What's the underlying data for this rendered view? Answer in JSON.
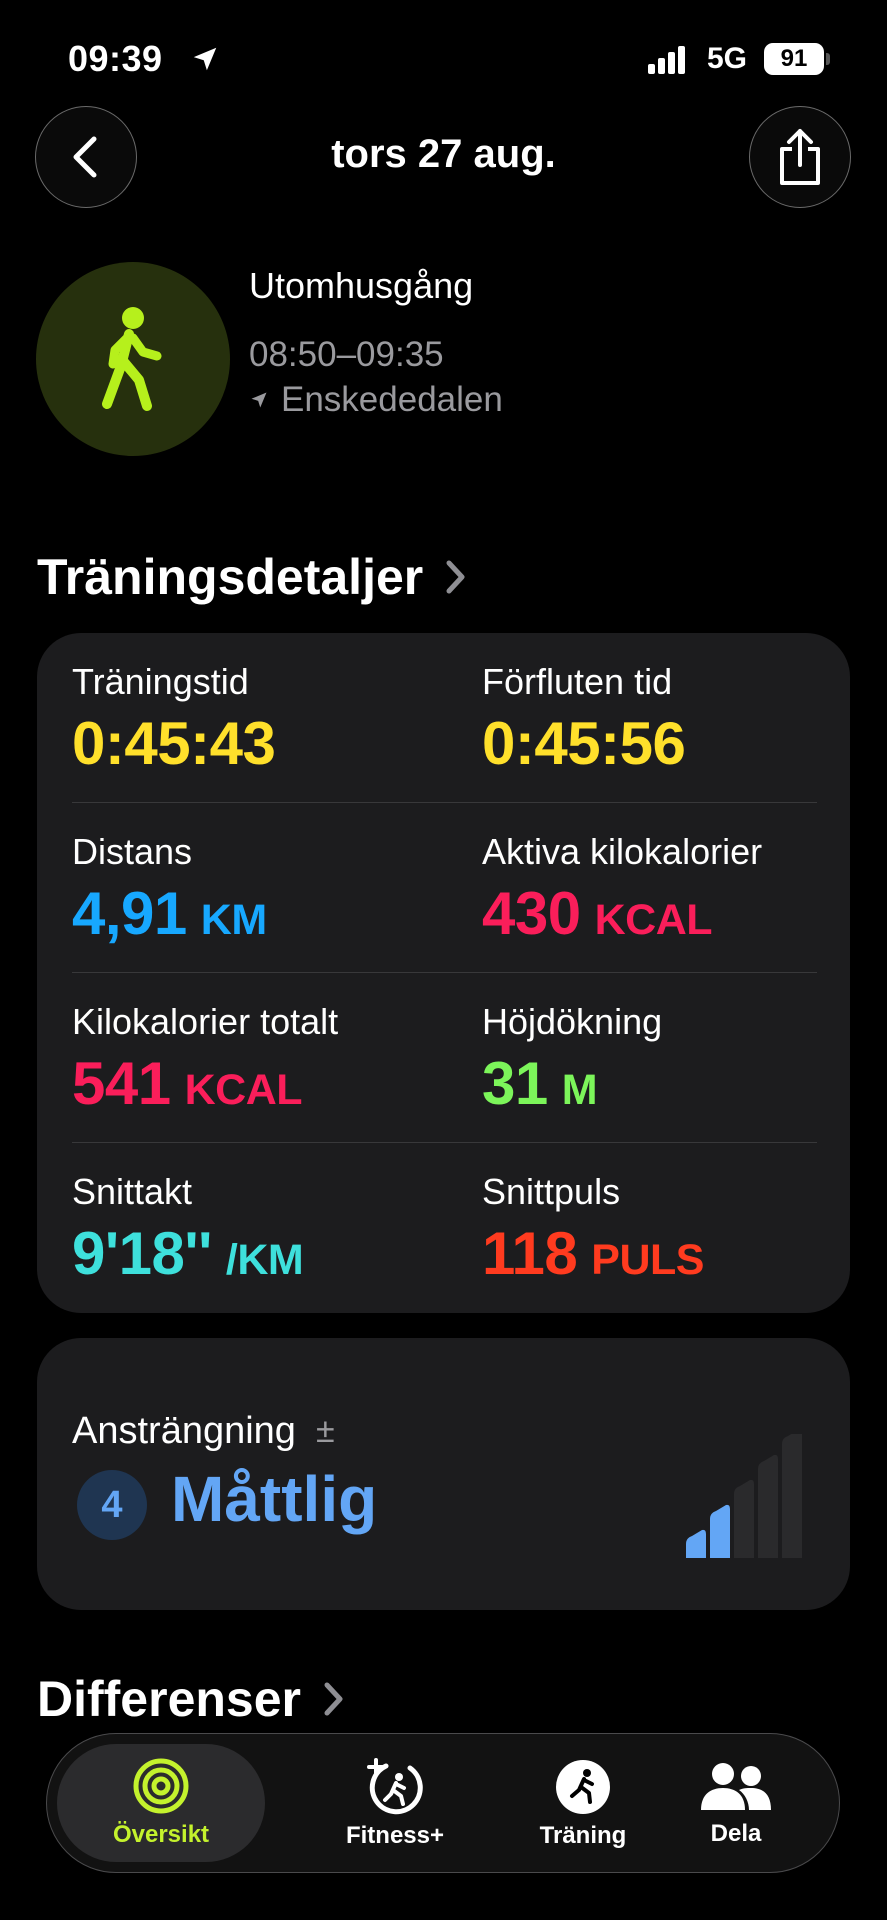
{
  "status_bar": {
    "time": "09:39",
    "network": "5G",
    "battery": "91"
  },
  "nav": {
    "title": "tors 27 aug."
  },
  "workout": {
    "type": "Utomhusgång",
    "time_range": "08:50–09:35",
    "location": "Enskededalen"
  },
  "details_section": {
    "title": "Träningsdetaljer"
  },
  "metrics": [
    {
      "label": "Träningstid",
      "value": "0:45:43",
      "unit": "",
      "color": "#ffe02b"
    },
    {
      "label": "Förfluten tid",
      "value": "0:45:56",
      "unit": "",
      "color": "#ffe02b"
    },
    {
      "label": "Distans",
      "value": "4,91",
      "unit": "KM",
      "color": "#17a8ff"
    },
    {
      "label": "Aktiva kilokalorier",
      "value": "430",
      "unit": "KCAL",
      "color": "#fa1e5a"
    },
    {
      "label": "Kilokalorier totalt",
      "value": "541",
      "unit": "KCAL",
      "color": "#fa1e5a"
    },
    {
      "label": "Höjdökning",
      "value": "31",
      "unit": "M",
      "color": "#7cf55a"
    },
    {
      "label": "Snittakt",
      "value": "9'18''",
      "unit": "/KM",
      "color": "#3ee0dc"
    },
    {
      "label": "Snittpuls",
      "value": "118",
      "unit": "PULS",
      "color": "#ff3b1f"
    }
  ],
  "effort": {
    "label": "Ansträngning",
    "symbol": "±",
    "score": "4",
    "level": "Måttlig",
    "bars_filled": 2,
    "bars_total": 5,
    "color": "#63a6f5"
  },
  "diff_section": {
    "title": "Differenser"
  },
  "tab_bar": {
    "tabs": [
      {
        "label": "Översikt",
        "icon": "activity-rings-icon",
        "active": true
      },
      {
        "label": "Fitness+",
        "icon": "fitness-plus-icon",
        "active": false
      },
      {
        "label": "Träning",
        "icon": "workout-runner-icon",
        "active": false
      },
      {
        "label": "Dela",
        "icon": "sharing-people-icon",
        "active": false
      }
    ]
  },
  "colors": {
    "accent_green": "#c4f22d",
    "card_bg": "#1c1c1e"
  }
}
